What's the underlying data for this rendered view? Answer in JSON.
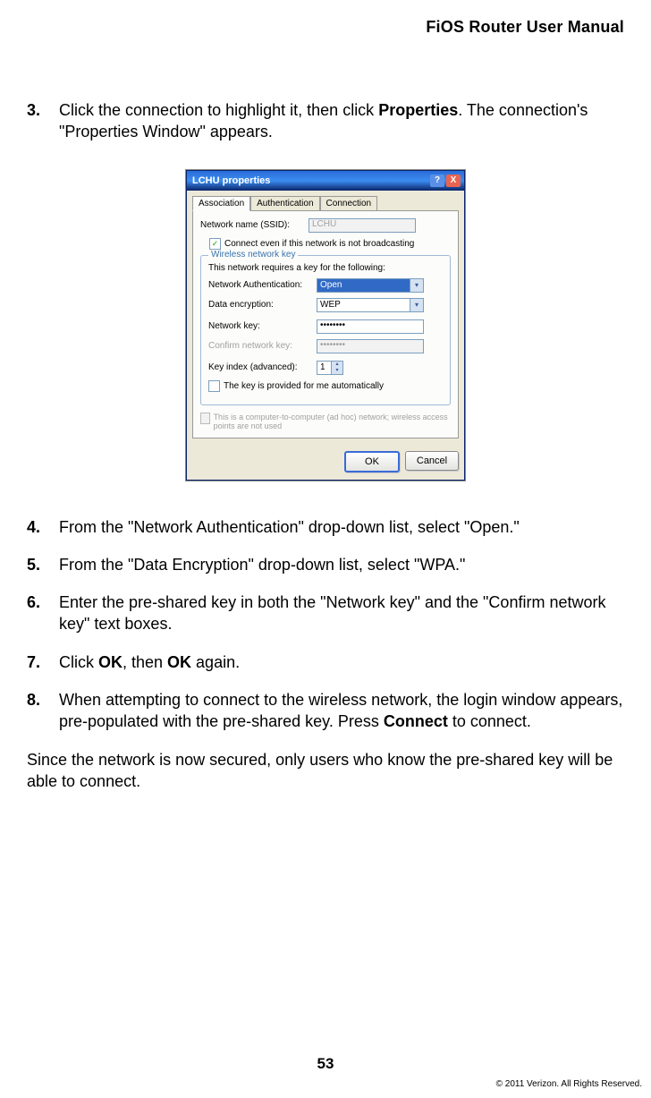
{
  "header": {
    "title": "FiOS Router User Manual"
  },
  "steps": [
    {
      "num": "3.",
      "parts": [
        "Click the connection to highlight it, then click ",
        {
          "b": "Properties"
        },
        ". The connection's \"Properties Window\" appears."
      ]
    },
    {
      "num": "4.",
      "parts": [
        "From the \"Network Authentication\" drop-down list, select \"Open.\""
      ]
    },
    {
      "num": "5.",
      "parts": [
        "From the \"Data Encryption\" drop-down list, select \"WPA.\""
      ]
    },
    {
      "num": "6.",
      "parts": [
        "Enter the pre-shared key in both the \"Network key\" and the \"Confirm network key\" text boxes."
      ]
    },
    {
      "num": "7.",
      "parts": [
        "Click ",
        {
          "b": "OK"
        },
        ", then ",
        {
          "b": "OK"
        },
        " again."
      ]
    },
    {
      "num": "8.",
      "parts": [
        "When attempting to connect to the wireless network, the login window appears, pre-populated with the pre-shared key. Press ",
        {
          "b": "Connect"
        },
        " to connect."
      ]
    }
  ],
  "closing": "Since the network is now secured, only users who know the pre-shared key will be able to connect.",
  "dialog": {
    "title": "LCHU properties",
    "tabs": [
      "Association",
      "Authentication",
      "Connection"
    ],
    "ssid_label": "Network name (SSID):",
    "ssid_value": "LCHU",
    "connect_cb_label": "Connect even if this network is not broadcasting",
    "connect_cb_checked": true,
    "fieldset_title": "Wireless network key",
    "fieldset_desc": "This network requires a key for the following:",
    "auth_label": "Network Authentication:",
    "auth_value": "Open",
    "enc_label": "Data encryption:",
    "enc_value": "WEP",
    "key_label": "Network key:",
    "key_value": "••••••••",
    "confirm_label": "Confirm network key:",
    "confirm_value": "••••••••",
    "index_label": "Key index (advanced):",
    "index_value": "1",
    "auto_cb_label": "The key is provided for me automatically",
    "adhoc_label": "This is a computer-to-computer (ad hoc) network; wireless access points are not used",
    "ok": "OK",
    "cancel": "Cancel"
  },
  "footer": {
    "page": "53",
    "copyright": "© 2011 Verizon. All Rights Reserved."
  }
}
